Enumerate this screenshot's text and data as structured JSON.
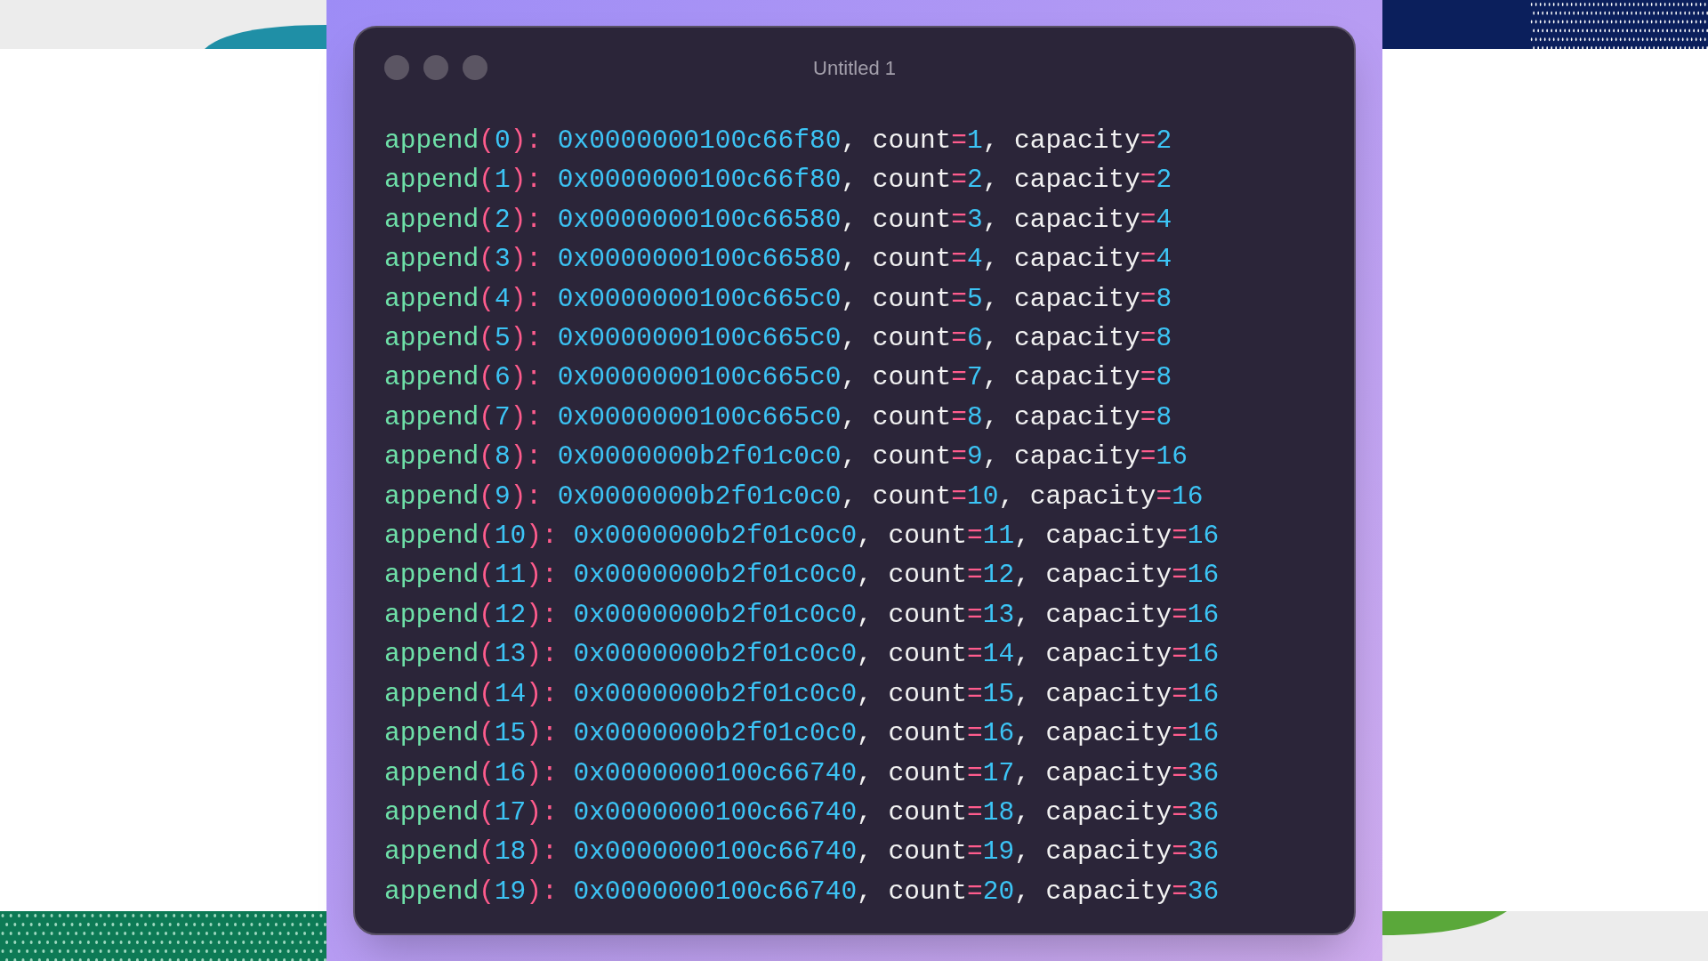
{
  "window": {
    "title": "Untitled 1"
  },
  "lines": [
    [
      {
        "kind": "fn",
        "text": "append"
      },
      {
        "kind": "op",
        "text": "("
      },
      {
        "kind": "num",
        "text": "0"
      },
      {
        "kind": "op",
        "text": "): "
      },
      {
        "kind": "addr",
        "text": "0x0000000100c66f80"
      },
      {
        "kind": "plain",
        "text": ", count"
      },
      {
        "kind": "op",
        "text": "="
      },
      {
        "kind": "num",
        "text": "1"
      },
      {
        "kind": "plain",
        "text": ", capacity"
      },
      {
        "kind": "op",
        "text": "="
      },
      {
        "kind": "num",
        "text": "2"
      }
    ],
    [
      {
        "kind": "fn",
        "text": "append"
      },
      {
        "kind": "op",
        "text": "("
      },
      {
        "kind": "num",
        "text": "1"
      },
      {
        "kind": "op",
        "text": "): "
      },
      {
        "kind": "addr",
        "text": "0x0000000100c66f80"
      },
      {
        "kind": "plain",
        "text": ", count"
      },
      {
        "kind": "op",
        "text": "="
      },
      {
        "kind": "num",
        "text": "2"
      },
      {
        "kind": "plain",
        "text": ", capacity"
      },
      {
        "kind": "op",
        "text": "="
      },
      {
        "kind": "num",
        "text": "2"
      }
    ],
    [
      {
        "kind": "fn",
        "text": "append"
      },
      {
        "kind": "op",
        "text": "("
      },
      {
        "kind": "num",
        "text": "2"
      },
      {
        "kind": "op",
        "text": "): "
      },
      {
        "kind": "addr",
        "text": "0x0000000100c66580"
      },
      {
        "kind": "plain",
        "text": ", count"
      },
      {
        "kind": "op",
        "text": "="
      },
      {
        "kind": "num",
        "text": "3"
      },
      {
        "kind": "plain",
        "text": ", capacity"
      },
      {
        "kind": "op",
        "text": "="
      },
      {
        "kind": "num",
        "text": "4"
      }
    ],
    [
      {
        "kind": "fn",
        "text": "append"
      },
      {
        "kind": "op",
        "text": "("
      },
      {
        "kind": "num",
        "text": "3"
      },
      {
        "kind": "op",
        "text": "): "
      },
      {
        "kind": "addr",
        "text": "0x0000000100c66580"
      },
      {
        "kind": "plain",
        "text": ", count"
      },
      {
        "kind": "op",
        "text": "="
      },
      {
        "kind": "num",
        "text": "4"
      },
      {
        "kind": "plain",
        "text": ", capacity"
      },
      {
        "kind": "op",
        "text": "="
      },
      {
        "kind": "num",
        "text": "4"
      }
    ],
    [
      {
        "kind": "fn",
        "text": "append"
      },
      {
        "kind": "op",
        "text": "("
      },
      {
        "kind": "num",
        "text": "4"
      },
      {
        "kind": "op",
        "text": "): "
      },
      {
        "kind": "addr",
        "text": "0x0000000100c665c0"
      },
      {
        "kind": "plain",
        "text": ", count"
      },
      {
        "kind": "op",
        "text": "="
      },
      {
        "kind": "num",
        "text": "5"
      },
      {
        "kind": "plain",
        "text": ", capacity"
      },
      {
        "kind": "op",
        "text": "="
      },
      {
        "kind": "num",
        "text": "8"
      }
    ],
    [
      {
        "kind": "fn",
        "text": "append"
      },
      {
        "kind": "op",
        "text": "("
      },
      {
        "kind": "num",
        "text": "5"
      },
      {
        "kind": "op",
        "text": "): "
      },
      {
        "kind": "addr",
        "text": "0x0000000100c665c0"
      },
      {
        "kind": "plain",
        "text": ", count"
      },
      {
        "kind": "op",
        "text": "="
      },
      {
        "kind": "num",
        "text": "6"
      },
      {
        "kind": "plain",
        "text": ", capacity"
      },
      {
        "kind": "op",
        "text": "="
      },
      {
        "kind": "num",
        "text": "8"
      }
    ],
    [
      {
        "kind": "fn",
        "text": "append"
      },
      {
        "kind": "op",
        "text": "("
      },
      {
        "kind": "num",
        "text": "6"
      },
      {
        "kind": "op",
        "text": "): "
      },
      {
        "kind": "addr",
        "text": "0x0000000100c665c0"
      },
      {
        "kind": "plain",
        "text": ", count"
      },
      {
        "kind": "op",
        "text": "="
      },
      {
        "kind": "num",
        "text": "7"
      },
      {
        "kind": "plain",
        "text": ", capacity"
      },
      {
        "kind": "op",
        "text": "="
      },
      {
        "kind": "num",
        "text": "8"
      }
    ],
    [
      {
        "kind": "fn",
        "text": "append"
      },
      {
        "kind": "op",
        "text": "("
      },
      {
        "kind": "num",
        "text": "7"
      },
      {
        "kind": "op",
        "text": "): "
      },
      {
        "kind": "addr",
        "text": "0x0000000100c665c0"
      },
      {
        "kind": "plain",
        "text": ", count"
      },
      {
        "kind": "op",
        "text": "="
      },
      {
        "kind": "num",
        "text": "8"
      },
      {
        "kind": "plain",
        "text": ", capacity"
      },
      {
        "kind": "op",
        "text": "="
      },
      {
        "kind": "num",
        "text": "8"
      }
    ],
    [
      {
        "kind": "fn",
        "text": "append"
      },
      {
        "kind": "op",
        "text": "("
      },
      {
        "kind": "num",
        "text": "8"
      },
      {
        "kind": "op",
        "text": "): "
      },
      {
        "kind": "addr",
        "text": "0x0000000b2f01c0c0"
      },
      {
        "kind": "plain",
        "text": ", count"
      },
      {
        "kind": "op",
        "text": "="
      },
      {
        "kind": "num",
        "text": "9"
      },
      {
        "kind": "plain",
        "text": ", capacity"
      },
      {
        "kind": "op",
        "text": "="
      },
      {
        "kind": "num",
        "text": "16"
      }
    ],
    [
      {
        "kind": "fn",
        "text": "append"
      },
      {
        "kind": "op",
        "text": "("
      },
      {
        "kind": "num",
        "text": "9"
      },
      {
        "kind": "op",
        "text": "): "
      },
      {
        "kind": "addr",
        "text": "0x0000000b2f01c0c0"
      },
      {
        "kind": "plain",
        "text": ", count"
      },
      {
        "kind": "op",
        "text": "="
      },
      {
        "kind": "num",
        "text": "10"
      },
      {
        "kind": "plain",
        "text": ", capacity"
      },
      {
        "kind": "op",
        "text": "="
      },
      {
        "kind": "num",
        "text": "16"
      }
    ],
    [
      {
        "kind": "fn",
        "text": "append"
      },
      {
        "kind": "op",
        "text": "("
      },
      {
        "kind": "num",
        "text": "10"
      },
      {
        "kind": "op",
        "text": "): "
      },
      {
        "kind": "addr",
        "text": "0x0000000b2f01c0c0"
      },
      {
        "kind": "plain",
        "text": ", count"
      },
      {
        "kind": "op",
        "text": "="
      },
      {
        "kind": "num",
        "text": "11"
      },
      {
        "kind": "plain",
        "text": ", capacity"
      },
      {
        "kind": "op",
        "text": "="
      },
      {
        "kind": "num",
        "text": "16"
      }
    ],
    [
      {
        "kind": "fn",
        "text": "append"
      },
      {
        "kind": "op",
        "text": "("
      },
      {
        "kind": "num",
        "text": "11"
      },
      {
        "kind": "op",
        "text": "): "
      },
      {
        "kind": "addr",
        "text": "0x0000000b2f01c0c0"
      },
      {
        "kind": "plain",
        "text": ", count"
      },
      {
        "kind": "op",
        "text": "="
      },
      {
        "kind": "num",
        "text": "12"
      },
      {
        "kind": "plain",
        "text": ", capacity"
      },
      {
        "kind": "op",
        "text": "="
      },
      {
        "kind": "num",
        "text": "16"
      }
    ],
    [
      {
        "kind": "fn",
        "text": "append"
      },
      {
        "kind": "op",
        "text": "("
      },
      {
        "kind": "num",
        "text": "12"
      },
      {
        "kind": "op",
        "text": "): "
      },
      {
        "kind": "addr",
        "text": "0x0000000b2f01c0c0"
      },
      {
        "kind": "plain",
        "text": ", count"
      },
      {
        "kind": "op",
        "text": "="
      },
      {
        "kind": "num",
        "text": "13"
      },
      {
        "kind": "plain",
        "text": ", capacity"
      },
      {
        "kind": "op",
        "text": "="
      },
      {
        "kind": "num",
        "text": "16"
      }
    ],
    [
      {
        "kind": "fn",
        "text": "append"
      },
      {
        "kind": "op",
        "text": "("
      },
      {
        "kind": "num",
        "text": "13"
      },
      {
        "kind": "op",
        "text": "): "
      },
      {
        "kind": "addr",
        "text": "0x0000000b2f01c0c0"
      },
      {
        "kind": "plain",
        "text": ", count"
      },
      {
        "kind": "op",
        "text": "="
      },
      {
        "kind": "num",
        "text": "14"
      },
      {
        "kind": "plain",
        "text": ", capacity"
      },
      {
        "kind": "op",
        "text": "="
      },
      {
        "kind": "num",
        "text": "16"
      }
    ],
    [
      {
        "kind": "fn",
        "text": "append"
      },
      {
        "kind": "op",
        "text": "("
      },
      {
        "kind": "num",
        "text": "14"
      },
      {
        "kind": "op",
        "text": "): "
      },
      {
        "kind": "addr",
        "text": "0x0000000b2f01c0c0"
      },
      {
        "kind": "plain",
        "text": ", count"
      },
      {
        "kind": "op",
        "text": "="
      },
      {
        "kind": "num",
        "text": "15"
      },
      {
        "kind": "plain",
        "text": ", capacity"
      },
      {
        "kind": "op",
        "text": "="
      },
      {
        "kind": "num",
        "text": "16"
      }
    ],
    [
      {
        "kind": "fn",
        "text": "append"
      },
      {
        "kind": "op",
        "text": "("
      },
      {
        "kind": "num",
        "text": "15"
      },
      {
        "kind": "op",
        "text": "): "
      },
      {
        "kind": "addr",
        "text": "0x0000000b2f01c0c0"
      },
      {
        "kind": "plain",
        "text": ", count"
      },
      {
        "kind": "op",
        "text": "="
      },
      {
        "kind": "num",
        "text": "16"
      },
      {
        "kind": "plain",
        "text": ", capacity"
      },
      {
        "kind": "op",
        "text": "="
      },
      {
        "kind": "num",
        "text": "16"
      }
    ],
    [
      {
        "kind": "fn",
        "text": "append"
      },
      {
        "kind": "op",
        "text": "("
      },
      {
        "kind": "num",
        "text": "16"
      },
      {
        "kind": "op",
        "text": "): "
      },
      {
        "kind": "addr",
        "text": "0x0000000100c66740"
      },
      {
        "kind": "plain",
        "text": ", count"
      },
      {
        "kind": "op",
        "text": "="
      },
      {
        "kind": "num",
        "text": "17"
      },
      {
        "kind": "plain",
        "text": ", capacity"
      },
      {
        "kind": "op",
        "text": "="
      },
      {
        "kind": "num",
        "text": "36"
      }
    ],
    [
      {
        "kind": "fn",
        "text": "append"
      },
      {
        "kind": "op",
        "text": "("
      },
      {
        "kind": "num",
        "text": "17"
      },
      {
        "kind": "op",
        "text": "): "
      },
      {
        "kind": "addr",
        "text": "0x0000000100c66740"
      },
      {
        "kind": "plain",
        "text": ", count"
      },
      {
        "kind": "op",
        "text": "="
      },
      {
        "kind": "num",
        "text": "18"
      },
      {
        "kind": "plain",
        "text": ", capacity"
      },
      {
        "kind": "op",
        "text": "="
      },
      {
        "kind": "num",
        "text": "36"
      }
    ],
    [
      {
        "kind": "fn",
        "text": "append"
      },
      {
        "kind": "op",
        "text": "("
      },
      {
        "kind": "num",
        "text": "18"
      },
      {
        "kind": "op",
        "text": "): "
      },
      {
        "kind": "addr",
        "text": "0x0000000100c66740"
      },
      {
        "kind": "plain",
        "text": ", count"
      },
      {
        "kind": "op",
        "text": "="
      },
      {
        "kind": "num",
        "text": "19"
      },
      {
        "kind": "plain",
        "text": ", capacity"
      },
      {
        "kind": "op",
        "text": "="
      },
      {
        "kind": "num",
        "text": "36"
      }
    ],
    [
      {
        "kind": "fn",
        "text": "append"
      },
      {
        "kind": "op",
        "text": "("
      },
      {
        "kind": "num",
        "text": "19"
      },
      {
        "kind": "op",
        "text": "): "
      },
      {
        "kind": "addr",
        "text": "0x0000000100c66740"
      },
      {
        "kind": "plain",
        "text": ", count"
      },
      {
        "kind": "op",
        "text": "="
      },
      {
        "kind": "num",
        "text": "20"
      },
      {
        "kind": "plain",
        "text": ", capacity"
      },
      {
        "kind": "op",
        "text": "="
      },
      {
        "kind": "num",
        "text": "36"
      }
    ]
  ]
}
